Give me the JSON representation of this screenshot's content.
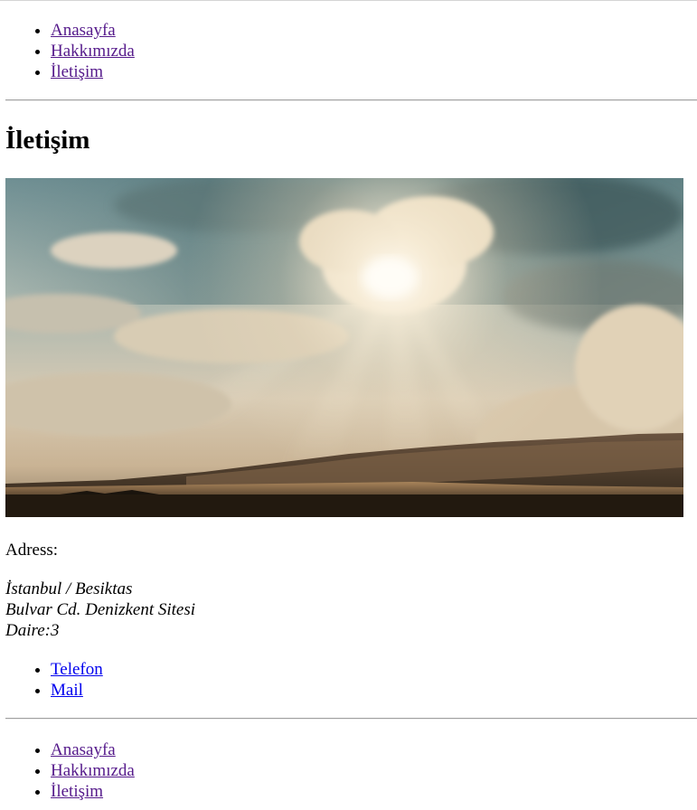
{
  "nav_top": {
    "items": [
      {
        "label": "Anasayfa"
      },
      {
        "label": "Hakkımızda"
      },
      {
        "label": "İletişim"
      }
    ]
  },
  "page": {
    "title": "İletişim"
  },
  "hero": {
    "subject": "sky with clouds and sun rays over desert dunes"
  },
  "address": {
    "label": "Adress:",
    "lines": [
      "İstanbul / Besiktas",
      "Bulvar Cd. Denizkent Sitesi",
      "Daire:3"
    ]
  },
  "contact_links": {
    "items": [
      {
        "label": "Telefon"
      },
      {
        "label": "Mail"
      }
    ]
  },
  "nav_bottom": {
    "items": [
      {
        "label": "Anasayfa"
      },
      {
        "label": "Hakkımızda"
      },
      {
        "label": "İletişim"
      }
    ]
  },
  "colors": {
    "link_visited": "#551a8b",
    "link_unvisited": "#0000ee",
    "text": "#000000"
  }
}
